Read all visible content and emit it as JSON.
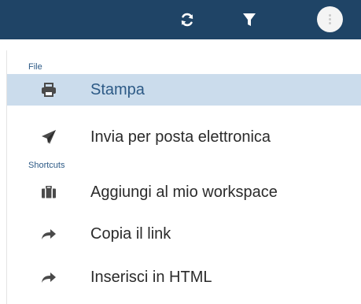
{
  "toolbar": {
    "refresh_icon": "refresh-icon",
    "filter_icon": "filter-icon",
    "more_icon": "kebab-menu-icon"
  },
  "menu": {
    "sections": [
      {
        "label": "File",
        "items": [
          {
            "label": "Stampa",
            "icon": "printer-icon",
            "selected": true
          },
          {
            "label": "Invia per posta elettronica",
            "icon": "send-icon",
            "selected": false
          }
        ]
      },
      {
        "label": "Shortcuts",
        "items": [
          {
            "label": "Aggiungi al mio workspace",
            "icon": "briefcase-icon",
            "selected": false
          },
          {
            "label": "Copia il link",
            "icon": "share-arrow-icon",
            "selected": false
          },
          {
            "label": "Inserisci in HTML",
            "icon": "share-arrow-icon",
            "selected": false
          }
        ]
      }
    ]
  },
  "colors": {
    "topbar": "#1f4466",
    "accent": "#2d5a86",
    "selected_bg": "#cbdcec",
    "icon": "#4a4a4a"
  }
}
